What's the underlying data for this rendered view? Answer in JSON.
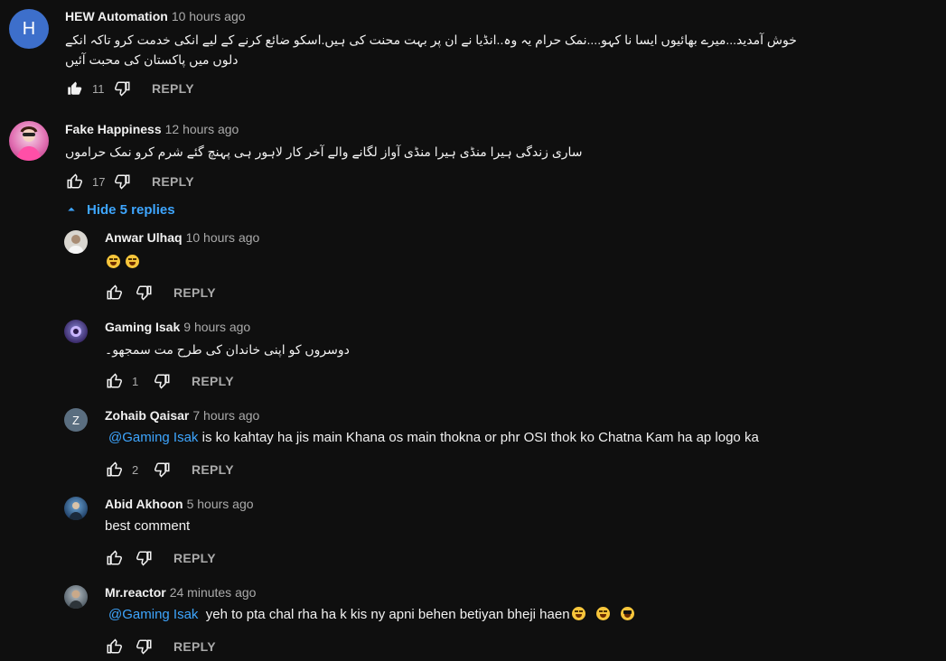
{
  "comments": [
    {
      "author": "HEW Automation",
      "time": "10 hours ago",
      "avatar_letter": "H",
      "avatar_color": "#3d6fcb",
      "text": "خوش آمدید...میرے بھائیوں ایسا نا کہو....نمک حرام یہ وہ..انڈیا نے ان پر بہت محنت کی ہیں.اسکو ضائع کرنے کے لیے انکی خدمت کرو تاکہ انکے دلوں میں پاکستان کی محبت آئیں",
      "likes": "11",
      "reply_label": "REPLY"
    },
    {
      "author": "Fake Happiness",
      "time": "12 hours ago",
      "text": "ساری زندگی ہیرا منڈی ہیرا منڈی آواز لگانے والے آخر کار لاہور ہی پہنچ گئے شرم کرو نمک حراموں",
      "likes": "17",
      "reply_label": "REPLY"
    }
  ],
  "hide_replies_label": "Hide 5 replies",
  "replies": [
    {
      "author": "Anwar Ulhaq",
      "time": "10 hours ago",
      "text": "",
      "emojis": [
        "laugh",
        "laugh"
      ],
      "likes": "",
      "reply_label": "REPLY"
    },
    {
      "author": "Gaming Isak",
      "time": "9 hours ago",
      "text": "دوسروں کو اپنی خاندان کی طرح مت سمجھو۔",
      "likes": "1",
      "reply_label": "REPLY"
    },
    {
      "author": "Zohaib Qaisar",
      "time": "7 hours ago",
      "avatar_letter": "Z",
      "avatar_color": "#5a6e80",
      "mention": "@Gaming Isak",
      "text": " is ko kahtay ha jis main Khana os main thokna or phr OSI thok ko Chatna Kam ha ap logo ka",
      "likes": "2",
      "reply_label": "REPLY"
    },
    {
      "author": "Abid Akhoon",
      "time": "5 hours ago",
      "text": "best comment",
      "likes": "",
      "reply_label": "REPLY"
    },
    {
      "author": "Mr.reactor",
      "time": "24 minutes ago",
      "mention": "@Gaming Isak",
      "text": "  yeh to pta chal rha ha k kis ny apni behen betiyan bheji haen",
      "emojis": [
        "laugh",
        "laugh",
        "cool"
      ],
      "likes": "",
      "reply_label": "REPLY"
    }
  ],
  "colors": {
    "background": "#0f0f0f",
    "link": "#3ea6ff",
    "secondary_text": "#aaaaaa"
  }
}
